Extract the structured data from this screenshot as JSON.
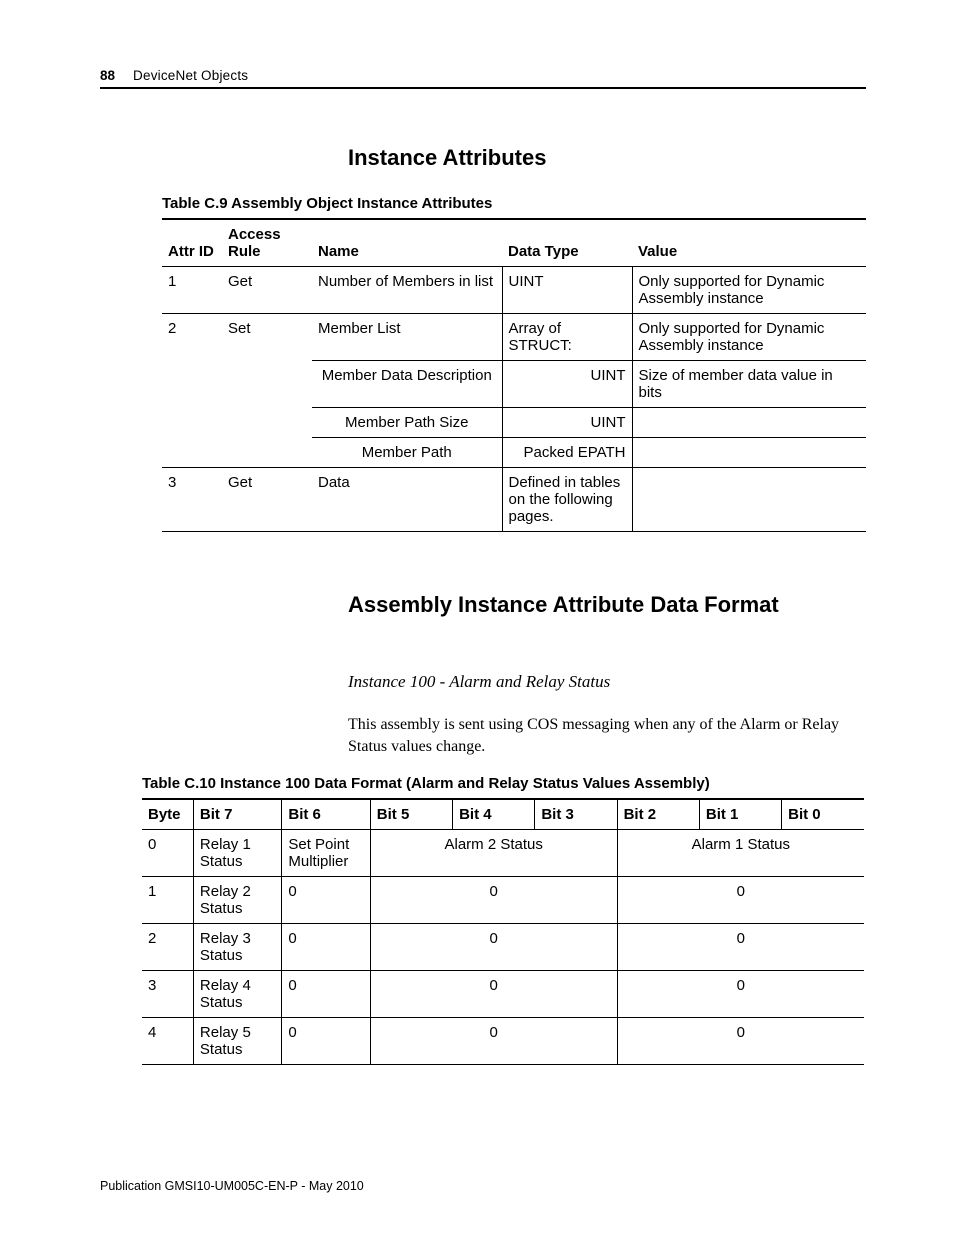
{
  "header": {
    "page_number": "88",
    "chapter_title": "DeviceNet Objects"
  },
  "section1": {
    "heading": "Instance Attributes",
    "table_caption": "Table C.9 Assembly Object Instance Attributes",
    "columns": {
      "c1": "Attr ID",
      "c2": "Access Rule",
      "c3": "Name",
      "c4": "Data Type",
      "c5": "Value"
    },
    "rows": {
      "r1": {
        "id": "1",
        "rule": "Get",
        "name": "Number of Members in list",
        "dtype": "UINT",
        "value": "Only supported for Dynamic Assembly instance"
      },
      "r2": {
        "id": "2",
        "rule": "Set",
        "name": "Member List",
        "dtype": "Array of STRUCT:",
        "value": "Only supported for Dynamic Assembly instance",
        "sub1_name": "Member Data Description",
        "sub1_dtype": "UINT",
        "sub1_value": "Size of member data value in bits",
        "sub2_name": "Member Path Size",
        "sub2_dtype": "UINT",
        "sub3_name": "Member Path",
        "sub3_dtype": "Packed EPATH"
      },
      "r3": {
        "id": "3",
        "rule": "Get",
        "name": "Data",
        "dtype": "Defined in tables on the following pages.",
        "value": ""
      }
    }
  },
  "section2": {
    "heading": "Assembly Instance Attribute Data Format",
    "subheading": "Instance 100 - Alarm and Relay Status",
    "body": "This assembly is sent using COS messaging when any of the Alarm or Relay Status values change.",
    "table_caption": "Table C.10 Instance 100 Data Format (Alarm and Relay Status Values Assembly)",
    "columns": {
      "byte": "Byte",
      "b7": "Bit 7",
      "b6": "Bit 6",
      "b5": "Bit 5",
      "b4": "Bit 4",
      "b3": "Bit 3",
      "b2": "Bit 2",
      "b1": "Bit 1",
      "b0": "Bit 0"
    },
    "rows": {
      "r0": {
        "byte": "0",
        "b7": "Relay 1 Status",
        "b6": "Set Point Multiplier",
        "g1": "Alarm 2 Status",
        "g2": "Alarm 1 Status"
      },
      "r1": {
        "byte": "1",
        "b7": "Relay 2 Status",
        "b6": "0",
        "g1": "0",
        "g2": "0"
      },
      "r2": {
        "byte": "2",
        "b7": "Relay 3 Status",
        "b6": "0",
        "g1": "0",
        "g2": "0"
      },
      "r3": {
        "byte": "3",
        "b7": "Relay 4 Status",
        "b6": "0",
        "g1": "0",
        "g2": "0"
      },
      "r4": {
        "byte": "4",
        "b7": "Relay 5 Status",
        "b6": "0",
        "g1": "0",
        "g2": "0"
      }
    }
  },
  "footer": {
    "text": "Publication GMSI10-UM005C-EN-P - May 2010"
  }
}
